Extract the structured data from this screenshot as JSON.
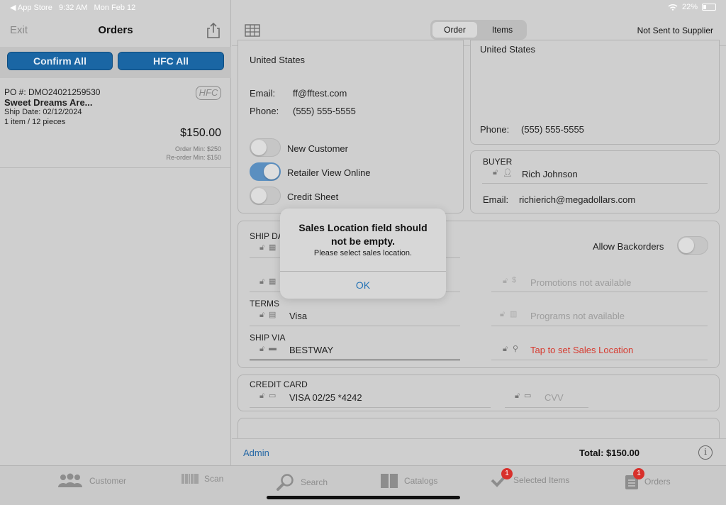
{
  "status_bar": {
    "back_app": "◀ App Store",
    "time": "9:32 AM",
    "date": "Mon Feb 12",
    "battery": "22%"
  },
  "left_header": {
    "exit": "Exit",
    "title": "Orders"
  },
  "left_buttons": {
    "confirm_all": "Confirm All",
    "hfc_all": "HFC All"
  },
  "order_item": {
    "po": "PO #: DMO24021259530",
    "name": "Sweet Dreams Are...",
    "ship_date": "Ship Date: 02/12/2024",
    "items": "1 item / 12 pieces",
    "badge": "HFC",
    "total": "$150.00",
    "order_min": "Order Min: $250",
    "reorder_min": "Re-order Min: $150"
  },
  "right_header": {
    "seg_order": "Order",
    "seg_items": "Items",
    "status": "Not Sent to Supplier"
  },
  "customer_panel": {
    "country": "United States",
    "email_label": "Email:",
    "email": "ff@fftest.com",
    "phone_label": "Phone:",
    "phone": "(555) 555-5555",
    "toggles": [
      {
        "label": "New Customer",
        "on": false
      },
      {
        "label": "Retailer View Online",
        "on": true
      },
      {
        "label": "Credit Sheet",
        "on": false
      }
    ]
  },
  "ship_panel": {
    "country": "United States",
    "phone_label": "Phone:",
    "phone": "(555) 555-5555"
  },
  "buyer_panel": {
    "label": "BUYER",
    "name": "Rich Johnson",
    "email_label": "Email:",
    "email": "richierich@megadollars.com"
  },
  "order_details": {
    "ship_date_label": "SHIP DA",
    "allow_backorders": "Allow Backorders",
    "promotions": "Promotions not available",
    "terms_label": "TERMS",
    "terms": "Visa",
    "programs": "Programs not available",
    "ship_via_label": "SHIP VIA",
    "ship_via": "BESTWAY",
    "sales_location": "Tap to set Sales Location"
  },
  "credit_card": {
    "label": "CREDIT CARD",
    "card": "VISA 02/25 *4242",
    "cvv_placeholder": "CVV"
  },
  "footer": {
    "admin": "Admin",
    "total": "Total:  $150.00",
    "info": "i"
  },
  "tabs": [
    {
      "label": "Customer",
      "icon": "people-icon"
    },
    {
      "label": "Scan",
      "icon": "barcode-icon"
    },
    {
      "label": "Search",
      "icon": "search-icon"
    },
    {
      "label": "Catalogs",
      "icon": "book-icon"
    },
    {
      "label": "Selected Items",
      "icon": "checkmark-icon",
      "badge": "1"
    },
    {
      "label": "Orders",
      "icon": "clipboard-icon",
      "badge": "1"
    }
  ],
  "alert": {
    "title": "Sales Location field should not be empty.",
    "message": "Please select sales location.",
    "ok": "OK"
  },
  "colors": {
    "accent": "#1a66a4",
    "link": "#2774b6",
    "error": "#d63a2f",
    "badge": "#d8302b"
  }
}
